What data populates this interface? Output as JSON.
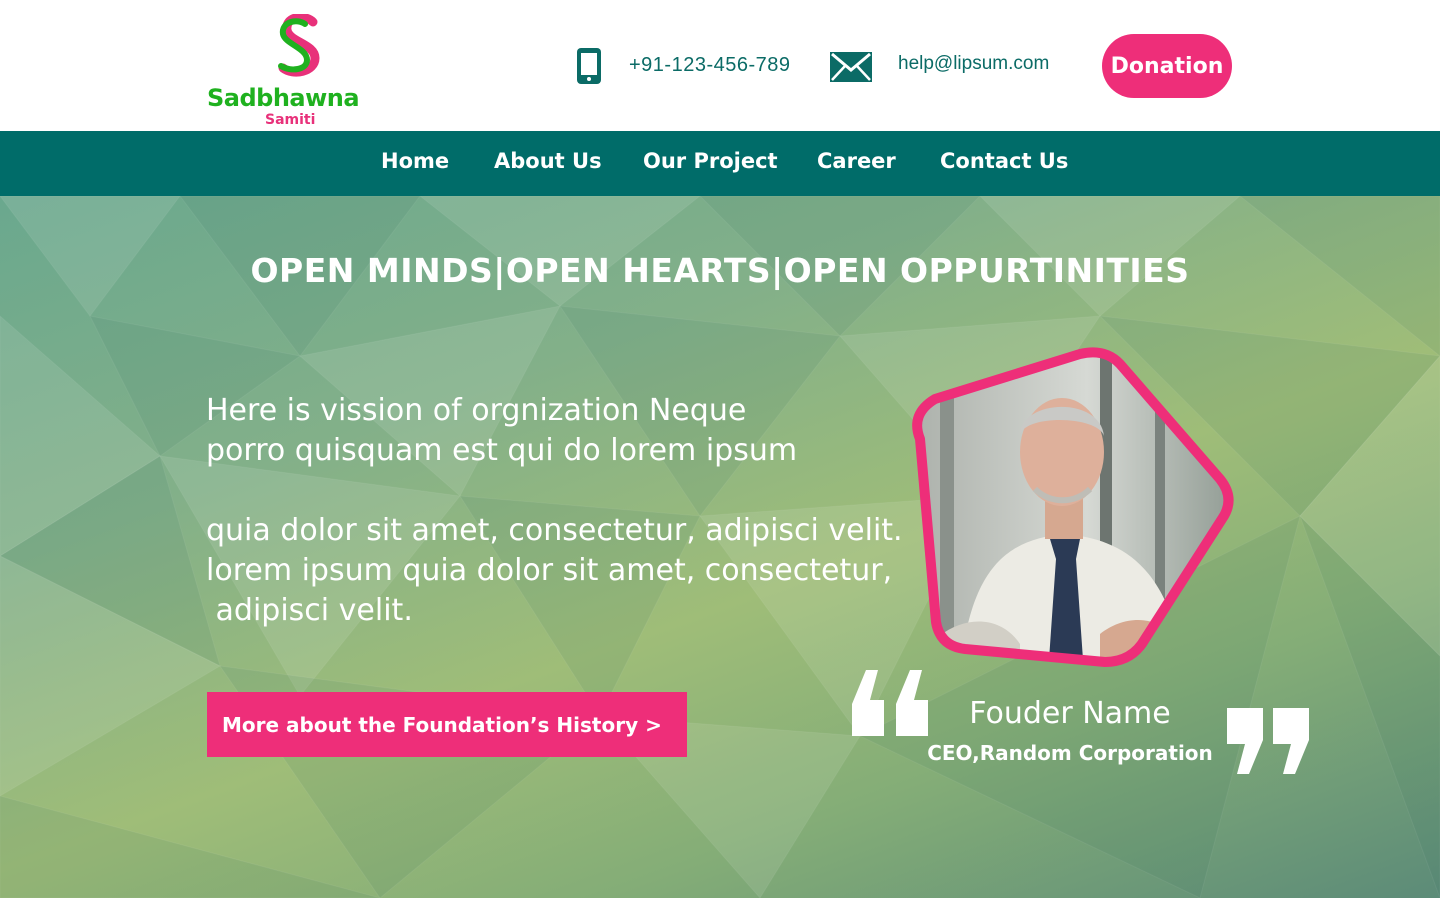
{
  "brand": {
    "name": "Sadbhawna",
    "sub": "Samiti",
    "mark": "S",
    "colors": {
      "green": "#1fb11f",
      "pink": "#e8317a"
    }
  },
  "contact": {
    "phone": "+91-123-456-789",
    "email": "help@lipsum.com",
    "phone_icon": "mobile-phone-icon",
    "mail_icon": "envelope-icon"
  },
  "header": {
    "donate_label": "Donation"
  },
  "nav": {
    "items": [
      "Home",
      "About Us",
      "Our Project",
      "Career",
      "Contact Us"
    ]
  },
  "hero": {
    "tagline": "OPEN MINDS|OPEN HEARTS|OPEN OPPURTINITIES",
    "vision_1": "Here is vission of orgnization Neque\nporro quisquam est qui do lorem ipsum",
    "vision_2": "quia dolor sit amet, consectetur, adipisci velit.\nlorem ipsum quia dolor sit amet, consectetur,\n adipisci velit.",
    "cta_label": "More about the Foundation’s History >",
    "founder_name": "Fouder Name",
    "founder_title": "CEO,Random Corporation"
  },
  "colors": {
    "teal": "#006c69",
    "pink": "#ee2e79",
    "text_teal": "#0b6b66"
  }
}
